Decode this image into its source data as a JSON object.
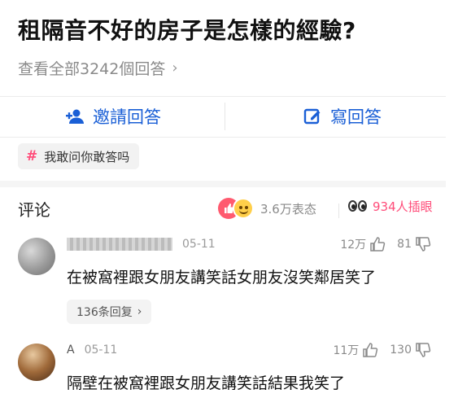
{
  "question": {
    "title": "租隔音不好的房子是怎樣的經驗?",
    "view_all": "查看全部3242個回答",
    "view_all_icon": "chevron-right-icon"
  },
  "actions": {
    "invite_label": "邀請回答",
    "invite_icon": "add-user-icon",
    "write_label": "寫回答",
    "write_icon": "edit-icon",
    "accent": "#1a5fd6"
  },
  "topic": {
    "label": "我敢问你敢答吗",
    "icon": "hashtag-icon",
    "accent": "#ff4d7a"
  },
  "comments_header": {
    "title": "评论",
    "reactions_text": "3.6万表态",
    "watch_text": "934人插眼",
    "watch_color": "#ff4d7a"
  },
  "comments": [
    {
      "date": "05-11",
      "text": "在被窩裡跟女朋友講笑話女朋友沒笑鄰居笑了",
      "likes": "12万",
      "dislikes": "81",
      "replies": "136条回复"
    },
    {
      "username": "A",
      "date": "05-11",
      "text": "隔壁在被窩裡跟女朋友講笑話結果我笑了",
      "likes": "11万",
      "dislikes": "130"
    }
  ]
}
